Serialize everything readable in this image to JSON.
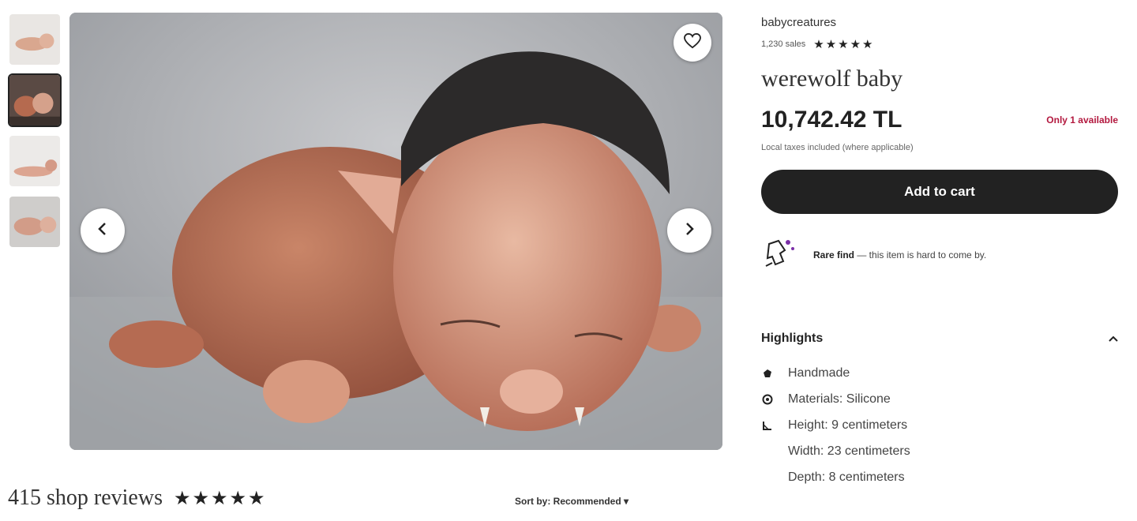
{
  "listing": {
    "shop_name": "babycreatures",
    "sales": "1,230 sales",
    "rating_stars": "★★★★★",
    "title": "werewolf baby",
    "price": "10,742.42 TL",
    "availability": "Only 1 available",
    "taxes_note": "Local taxes included (where applicable)",
    "add_to_cart": "Add to cart",
    "rare_find_label": "Rare find",
    "rare_find_text": " — this item is hard to come by."
  },
  "highlights": {
    "title": "Highlights",
    "items": [
      {
        "icon": "hand-icon",
        "text": "Handmade"
      },
      {
        "icon": "materials-icon",
        "text": "Materials: Silicone"
      },
      {
        "icon": "ruler-icon",
        "text": "Height: 9 centimeters"
      },
      {
        "icon": "",
        "text": "Width: 23 centimeters"
      },
      {
        "icon": "",
        "text": "Depth: 8 centimeters"
      }
    ]
  },
  "reviews": {
    "title": "415 shop reviews",
    "stars": "★★★★★",
    "sort": "Sort by: Recommended"
  },
  "colors": {
    "accent_dark": "#222222",
    "availability_red": "#b3193f"
  }
}
